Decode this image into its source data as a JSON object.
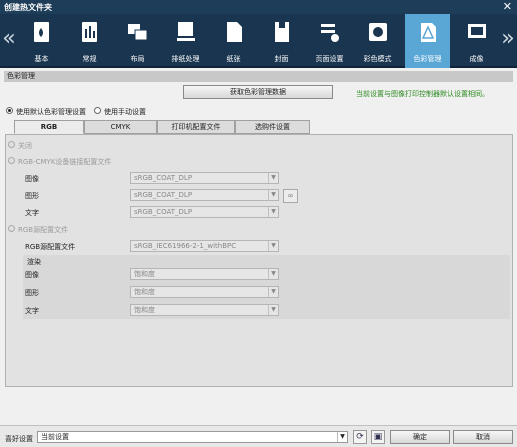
{
  "window": {
    "title": "创建热文件夹",
    "close": "✕"
  },
  "toolbar": {
    "items": [
      {
        "label": "基本",
        "icon": "basic-icon"
      },
      {
        "label": "常规",
        "icon": "general-icon"
      },
      {
        "label": "布局",
        "icon": "layout-icon"
      },
      {
        "label": "排纸处理",
        "icon": "output-icon"
      },
      {
        "label": "纸张",
        "icon": "paper-icon"
      },
      {
        "label": "封面",
        "icon": "cover-icon"
      },
      {
        "label": "页面设置",
        "icon": "page-setup-icon"
      },
      {
        "label": "彩色模式",
        "icon": "color-mode-icon"
      },
      {
        "label": "色彩管理",
        "icon": "color-management-icon"
      },
      {
        "label": "成像",
        "icon": "imaging-icon"
      }
    ],
    "active_index": 8,
    "left_arrow": "«",
    "right_arrow": "»",
    "active_color": "#5aa7d6"
  },
  "section": {
    "title": "色彩管理"
  },
  "get_data_button": "获取色彩管理数据",
  "green_note": "当前设置与图像打印控制器默认设置相同。",
  "mode": {
    "default_label": "使用默认色彩管理设置",
    "manual_label": "使用手动设置",
    "selected": "default"
  },
  "tabs": [
    "RGB",
    "CMYK",
    "打印机配置文件",
    "选购件设置"
  ],
  "rgb": {
    "off_label": "关闭",
    "link_label": "RGB-CMYK设备链接配置文件",
    "link_fields": [
      {
        "label": "图像",
        "value": "sRGB_COAT_DLP"
      },
      {
        "label": "图形",
        "value": "sRGB_COAT_DLP"
      },
      {
        "label": "文字",
        "value": "sRGB_COAT_DLP"
      }
    ],
    "source_label": "RGB源配置文件",
    "source_field_label": "RGB源配置文件",
    "source_value": "sRGB_IEC61966-2-1_withBPC",
    "render_title": "渲染",
    "render_fields": [
      {
        "label": "图像",
        "value": "饱和度"
      },
      {
        "label": "图形",
        "value": "饱和度"
      },
      {
        "label": "文字",
        "value": "饱和度"
      }
    ],
    "link_icon": "chain-link-icon"
  },
  "bottom": {
    "fav_label": "喜好设置",
    "fav_value": "当前设置",
    "ok": "确定",
    "cancel": "取消",
    "refresh_icon": "refresh-icon",
    "save_icon": "save-icon"
  }
}
